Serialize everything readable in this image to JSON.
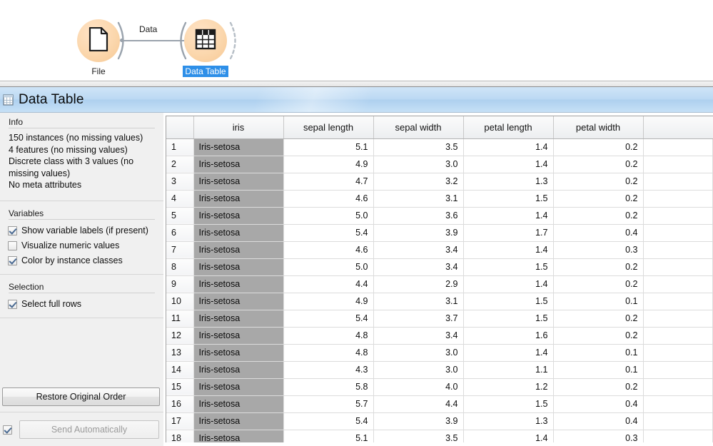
{
  "canvas": {
    "nodes": [
      {
        "id": "file",
        "label": "File",
        "icon": "document-icon",
        "selected": false
      },
      {
        "id": "data-table",
        "label": "Data Table",
        "icon": "table-icon",
        "selected": true
      }
    ],
    "link": {
      "label": "Data"
    }
  },
  "window": {
    "title": "Data Table",
    "title_icon": "table-icon"
  },
  "sidebar": {
    "info": {
      "title": "Info",
      "lines": [
        "150 instances (no missing values)",
        "4 features (no missing values)",
        "Discrete class with 3 values (no missing values)",
        "No meta attributes"
      ]
    },
    "variables": {
      "title": "Variables",
      "options": [
        {
          "label": "Show variable labels (if present)",
          "checked": true
        },
        {
          "label": "Visualize numeric values",
          "checked": false
        },
        {
          "label": "Color by instance classes",
          "checked": true
        }
      ]
    },
    "selection": {
      "title": "Selection",
      "options": [
        {
          "label": "Select full rows",
          "checked": true
        }
      ]
    },
    "restore_button": "Restore Original Order",
    "send": {
      "label": "Send Automatically",
      "checked": true,
      "disabled": true
    }
  },
  "table": {
    "columns": [
      "",
      "iris",
      "sepal length",
      "sepal width",
      "petal length",
      "petal width",
      ""
    ],
    "rows": [
      {
        "n": "1",
        "iris": "Iris-setosa",
        "sepal_length": "5.1",
        "sepal_width": "3.5",
        "petal_length": "1.4",
        "petal_width": "0.2"
      },
      {
        "n": "2",
        "iris": "Iris-setosa",
        "sepal_length": "4.9",
        "sepal_width": "3.0",
        "petal_length": "1.4",
        "petal_width": "0.2"
      },
      {
        "n": "3",
        "iris": "Iris-setosa",
        "sepal_length": "4.7",
        "sepal_width": "3.2",
        "petal_length": "1.3",
        "petal_width": "0.2"
      },
      {
        "n": "4",
        "iris": "Iris-setosa",
        "sepal_length": "4.6",
        "sepal_width": "3.1",
        "petal_length": "1.5",
        "petal_width": "0.2"
      },
      {
        "n": "5",
        "iris": "Iris-setosa",
        "sepal_length": "5.0",
        "sepal_width": "3.6",
        "petal_length": "1.4",
        "petal_width": "0.2"
      },
      {
        "n": "6",
        "iris": "Iris-setosa",
        "sepal_length": "5.4",
        "sepal_width": "3.9",
        "petal_length": "1.7",
        "petal_width": "0.4"
      },
      {
        "n": "7",
        "iris": "Iris-setosa",
        "sepal_length": "4.6",
        "sepal_width": "3.4",
        "petal_length": "1.4",
        "petal_width": "0.3"
      },
      {
        "n": "8",
        "iris": "Iris-setosa",
        "sepal_length": "5.0",
        "sepal_width": "3.4",
        "petal_length": "1.5",
        "petal_width": "0.2"
      },
      {
        "n": "9",
        "iris": "Iris-setosa",
        "sepal_length": "4.4",
        "sepal_width": "2.9",
        "petal_length": "1.4",
        "petal_width": "0.2"
      },
      {
        "n": "10",
        "iris": "Iris-setosa",
        "sepal_length": "4.9",
        "sepal_width": "3.1",
        "petal_length": "1.5",
        "petal_width": "0.1"
      },
      {
        "n": "11",
        "iris": "Iris-setosa",
        "sepal_length": "5.4",
        "sepal_width": "3.7",
        "petal_length": "1.5",
        "petal_width": "0.2"
      },
      {
        "n": "12",
        "iris": "Iris-setosa",
        "sepal_length": "4.8",
        "sepal_width": "3.4",
        "petal_length": "1.6",
        "petal_width": "0.2"
      },
      {
        "n": "13",
        "iris": "Iris-setosa",
        "sepal_length": "4.8",
        "sepal_width": "3.0",
        "petal_length": "1.4",
        "petal_width": "0.1"
      },
      {
        "n": "14",
        "iris": "Iris-setosa",
        "sepal_length": "4.3",
        "sepal_width": "3.0",
        "petal_length": "1.1",
        "petal_width": "0.1"
      },
      {
        "n": "15",
        "iris": "Iris-setosa",
        "sepal_length": "5.8",
        "sepal_width": "4.0",
        "petal_length": "1.2",
        "petal_width": "0.2"
      },
      {
        "n": "16",
        "iris": "Iris-setosa",
        "sepal_length": "5.7",
        "sepal_width": "4.4",
        "petal_length": "1.5",
        "petal_width": "0.4"
      },
      {
        "n": "17",
        "iris": "Iris-setosa",
        "sepal_length": "5.4",
        "sepal_width": "3.9",
        "petal_length": "1.3",
        "petal_width": "0.4"
      },
      {
        "n": "18",
        "iris": "Iris-setosa",
        "sepal_length": "5.1",
        "sepal_width": "3.5",
        "petal_length": "1.4",
        "petal_width": "0.3"
      }
    ]
  },
  "colors": {
    "widget_fill": "#f6c894",
    "selection_blue": "#2e8fe8",
    "titlebar_blue": "#bcd9f3",
    "class_cell_gray": "#a8a8a8"
  }
}
